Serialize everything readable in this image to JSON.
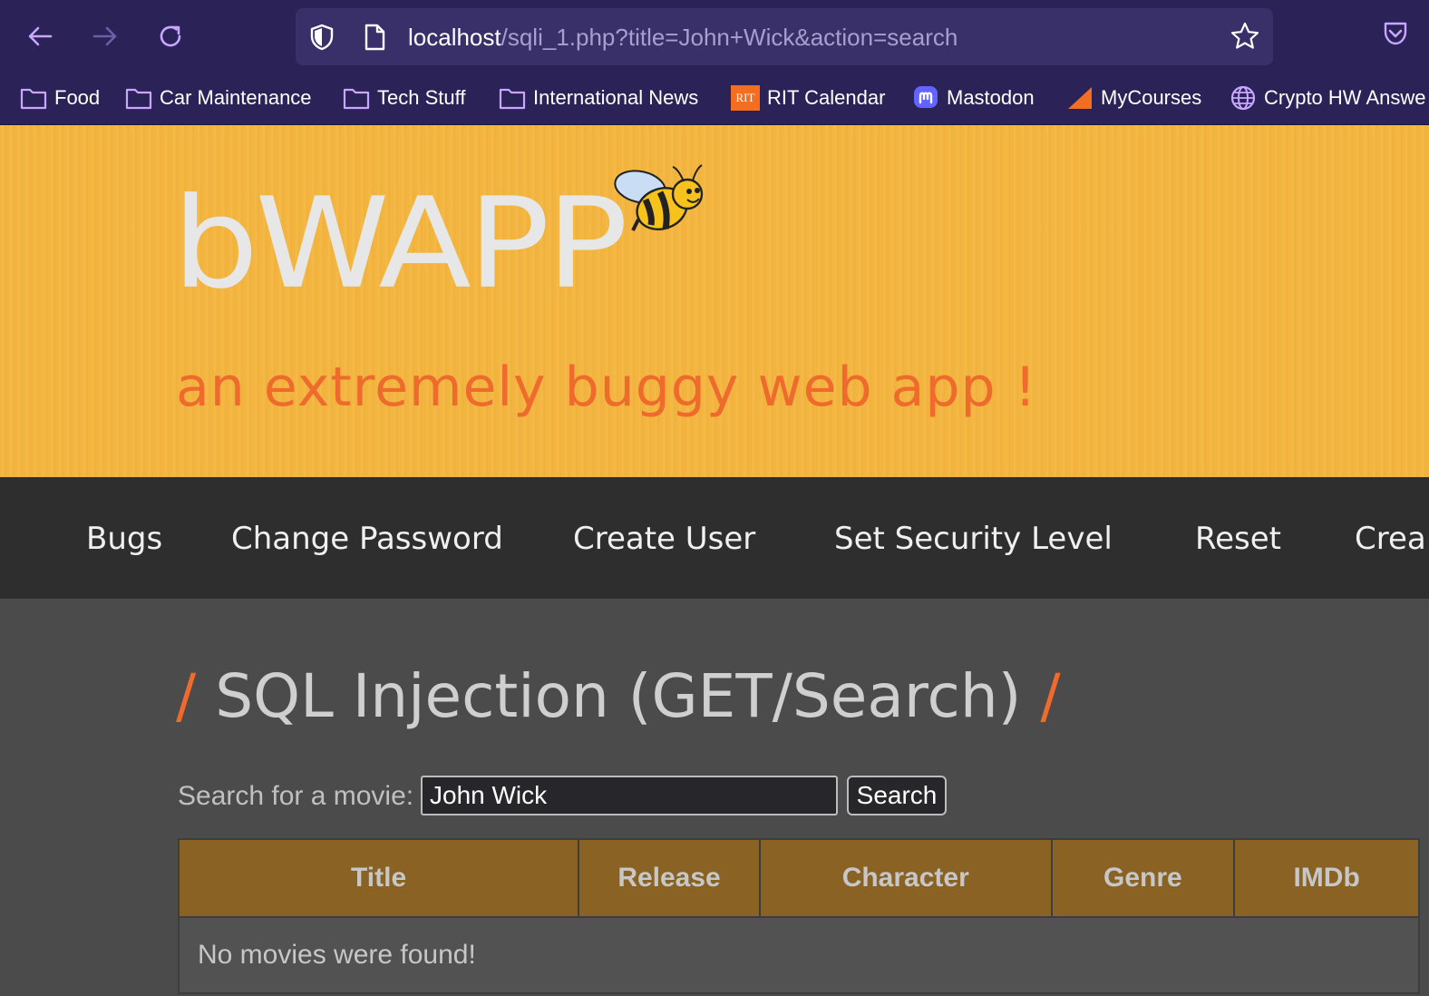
{
  "browser": {
    "url_host": "localhost",
    "url_path": "/sqli_1.php?title=John+Wick&action=search",
    "bookmarks": [
      {
        "label": "Food",
        "icon": "folder-icon"
      },
      {
        "label": "Car Maintenance",
        "icon": "folder-icon"
      },
      {
        "label": "Tech Stuff",
        "icon": "folder-icon"
      },
      {
        "label": "International News",
        "icon": "folder-icon"
      },
      {
        "label": "RIT Calendar",
        "icon": "rit-icon"
      },
      {
        "label": "Mastodon",
        "icon": "mastodon-icon"
      },
      {
        "label": "MyCourses",
        "icon": "mycourses-icon"
      },
      {
        "label": "Crypto HW Answe",
        "icon": "globe-icon"
      }
    ],
    "rit_icon_text": "RIT",
    "accent_color": "#c9a6ff"
  },
  "site": {
    "logo": "bWAPP",
    "tagline": "an extremely buggy web app !",
    "menu": [
      "Bugs",
      "Change Password",
      "Create User",
      "Set Security Level",
      "Reset",
      "Crea"
    ]
  },
  "page": {
    "title_slash_left": "/",
    "title": "SQL Injection (GET/Search)",
    "title_slash_right": "/",
    "search_label": "Search for a movie:",
    "search_value": "John Wick",
    "search_button": "Search",
    "table": {
      "headers": [
        "Title",
        "Release",
        "Character",
        "Genre",
        "IMDb"
      ],
      "empty_message": "No movies were found!"
    }
  }
}
